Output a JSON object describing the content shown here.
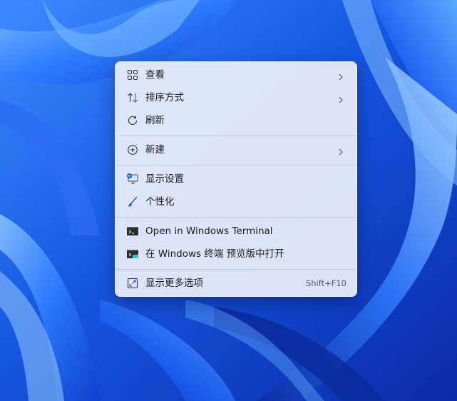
{
  "menu": {
    "items": [
      {
        "label": "查看",
        "icon": "grid-icon",
        "submenu": true
      },
      {
        "label": "排序方式",
        "icon": "sort-icon",
        "submenu": true
      },
      {
        "label": "刷新",
        "icon": "refresh-icon",
        "submenu": false
      },
      {
        "label": "新建",
        "icon": "add-circle-icon",
        "submenu": true
      },
      {
        "label": "显示设置",
        "icon": "display-settings-icon",
        "submenu": false
      },
      {
        "label": "个性化",
        "icon": "brush-icon",
        "submenu": false
      },
      {
        "label": "Open in Windows Terminal",
        "icon": "terminal-icon",
        "submenu": false
      },
      {
        "label": "在 Windows 终端 预览版中打开",
        "icon": "terminal-preview-icon",
        "submenu": false
      },
      {
        "label": "显示更多选项",
        "icon": "open-external-icon",
        "submenu": false,
        "shortcut": "Shift+F10"
      }
    ]
  },
  "colors": {
    "wallpaper_base": "#1a5fe0",
    "menu_background": "#e8ecfa",
    "text": "#1b1b1b",
    "accent": "#0a66d8"
  }
}
